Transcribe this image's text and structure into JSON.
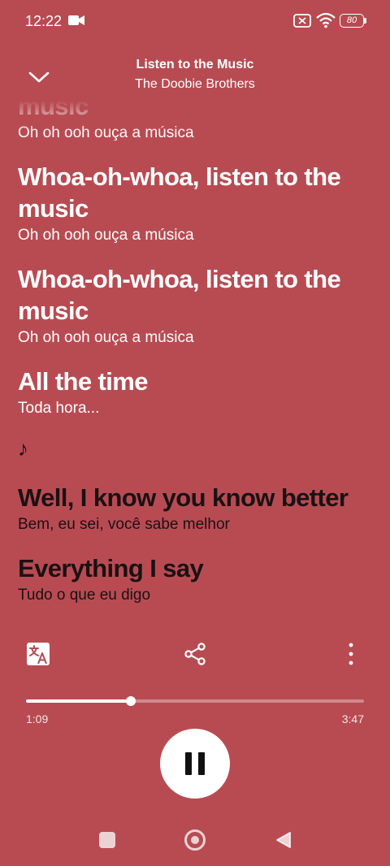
{
  "status_bar": {
    "time": "12:22",
    "battery_level": "80"
  },
  "header": {
    "title": "Listen to the Music",
    "artist": "The Doobie Brothers"
  },
  "lyrics": [
    {
      "line": "music",
      "translation": "Oh oh ooh ouça a música",
      "state": "past"
    },
    {
      "line": "Whoa-oh-whoa, listen to the music",
      "translation": "Oh oh ooh ouça a música",
      "state": "past"
    },
    {
      "line": "Whoa-oh-whoa, listen to the music",
      "translation": "Oh oh ooh ouça a música",
      "state": "past"
    },
    {
      "line": "All the time",
      "translation": "Toda hora...",
      "state": "past"
    },
    {
      "line": "♪",
      "translation": "",
      "state": "instrumental"
    },
    {
      "line": "Well, I know you know better",
      "translation": "Bem, eu sei, você sabe melhor",
      "state": "upcoming"
    },
    {
      "line": "Everything I say",
      "translation": "Tudo o que eu digo",
      "state": "upcoming"
    }
  ],
  "playback": {
    "elapsed": "1:09",
    "total": "3:47",
    "progress_fraction": 0.31,
    "state": "playing"
  },
  "icons": {
    "collapse": "chevron-down-icon",
    "translate": "translate-icon",
    "share": "share-icon",
    "more": "more-vertical-icon",
    "pause": "pause-icon"
  },
  "colors": {
    "background": "#B84B52",
    "upcoming_text": "#1a1113",
    "past_text": "#ffffff"
  }
}
